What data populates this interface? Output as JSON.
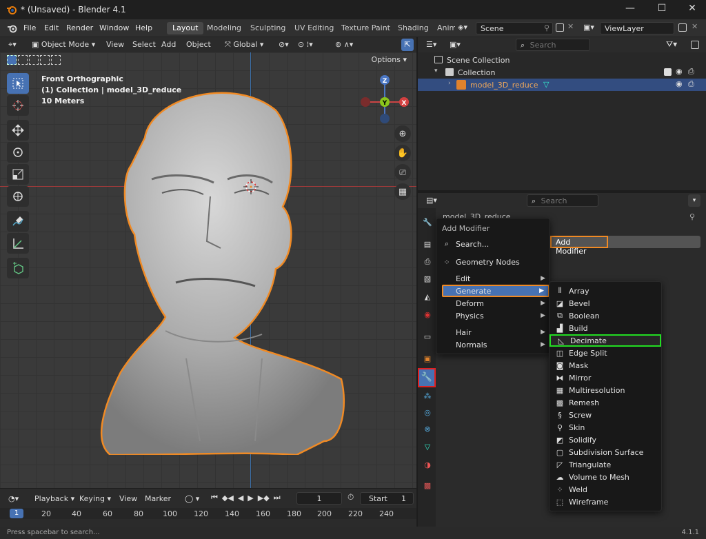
{
  "window": {
    "title": "* (Unsaved) - Blender 4.1",
    "minimize": "—",
    "maximize": "☐",
    "close": "✕"
  },
  "menubar": {
    "items": [
      "File",
      "Edit",
      "Render",
      "Window",
      "Help"
    ],
    "workspaces": [
      "Layout",
      "Modeling",
      "Sculpting",
      "UV Editing",
      "Texture Paint",
      "Shading",
      "Anim"
    ],
    "scene_label": "Scene",
    "viewlayer_label": "ViewLayer"
  },
  "viewport_header": {
    "mode": "Object Mode",
    "menus": [
      "View",
      "Select",
      "Add",
      "Object"
    ],
    "orientation": "Global",
    "options": "Options"
  },
  "viewport": {
    "view_name": "Front Orthographic",
    "collection_info": "(1) Collection | model_3D_reduce",
    "scale": "10 Meters",
    "gizmo": {
      "z": "Z",
      "y": "Y",
      "x": "X"
    }
  },
  "timeline": {
    "menus": [
      "Playback",
      "Keying",
      "View",
      "Marker"
    ],
    "current_frame": "1",
    "start_label": "Start",
    "start_value": "1",
    "ticks": [
      "1",
      "20",
      "40",
      "60",
      "80",
      "100",
      "120",
      "140",
      "160",
      "180",
      "200",
      "220",
      "240"
    ]
  },
  "statusbar": {
    "hint": "Press spacebar to search...",
    "version": "4.1.1"
  },
  "outliner": {
    "search_placeholder": "Search",
    "rows": [
      {
        "label": "Scene Collection"
      },
      {
        "label": "Collection"
      },
      {
        "label": "model_3D_reduce"
      }
    ]
  },
  "properties": {
    "search_placeholder": "Search",
    "object_name": "model_3D_reduce",
    "add_modifier_button": "Add Modifier"
  },
  "add_modifier_menu": {
    "title": "Add Modifier",
    "search": "Search...",
    "geometry_nodes": "Geometry Nodes",
    "items": [
      "Edit",
      "Generate",
      "Deform",
      "Physics",
      "Hair",
      "Normals"
    ]
  },
  "generate_menu": {
    "items": [
      "Array",
      "Bevel",
      "Boolean",
      "Build",
      "Decimate",
      "Edge Split",
      "Mask",
      "Mirror",
      "Multiresolution",
      "Remesh",
      "Screw",
      "Skin",
      "Solidify",
      "Subdivision Surface",
      "Triangulate",
      "Volume to Mesh",
      "Weld",
      "Wireframe"
    ]
  },
  "colors": {
    "accent": "#4772b3",
    "selection_orange": "#f08a24",
    "highlight_red": "#e02020",
    "highlight_green": "#22dd22"
  }
}
